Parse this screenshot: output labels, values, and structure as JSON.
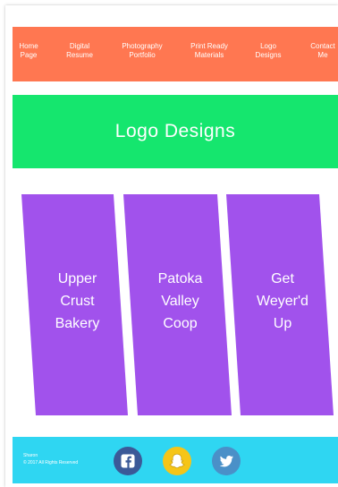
{
  "nav": {
    "items": [
      {
        "label": "Home\nPage"
      },
      {
        "label": "Digital\nResume"
      },
      {
        "label": "Photography\nPortfolio"
      },
      {
        "label": "Print Ready\nMaterials"
      },
      {
        "label": "Logo\nDesigns"
      },
      {
        "label": "Contact\nMe"
      }
    ]
  },
  "hero": {
    "title": "Logo Designs"
  },
  "cards": [
    {
      "label": "Upper\nCrust\nBakery"
    },
    {
      "label": "Patoka\nValley\nCoop"
    },
    {
      "label": "Get\nWeyer'd\nUp"
    }
  ],
  "footer": {
    "text": "Sharon\n© 2017 All Rights Reserved",
    "social": [
      "facebook-icon",
      "snapchat-icon",
      "twitter-icon"
    ]
  },
  "colors": {
    "nav": "#ff7751",
    "hero": "#15e66e",
    "card": "#a152ec",
    "footer": "#2fd6f2",
    "facebook": "#3b5998",
    "snapchat": "#f5c518",
    "twitter": "#4a90c8"
  }
}
